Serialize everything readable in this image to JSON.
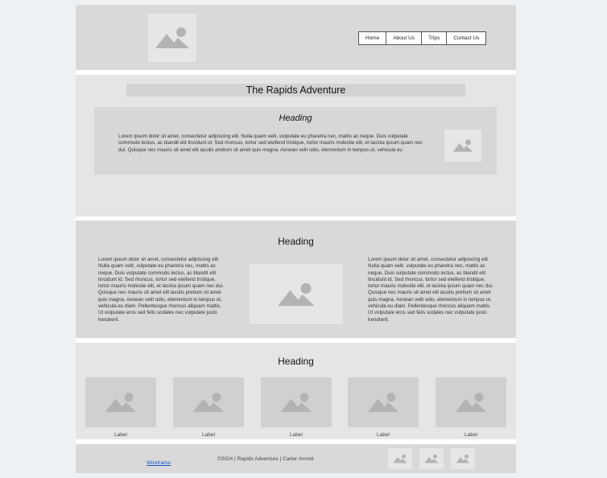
{
  "header": {
    "logo_icon": "image-placeholder-icon",
    "nav": [
      "Home",
      "About Us",
      "Trips",
      "Contact Us"
    ]
  },
  "intro": {
    "title": "The Rapids Adventure",
    "card": {
      "heading": "Heading",
      "text": "Lorem ipsum dolor sit amet, consectetur adipiscing elit. Nulla quam velit, vulputate eu pharetra nec, mattis ac neque. Duis vulputate commodo lectus, ac blandit elit tincidunt id. Sed rhoncus, tortor sed eleifend tristique, tortor mauris molestie elit, et lacinia ipsum quam nec dui. Quisque nec mauris sit amet elit iaculis pretium sit amet quis magna. Aenean velit odio, elementum in tempus ut, vehicula eu"
    }
  },
  "two_col": {
    "heading": "Heading",
    "left_text": "Lorem ipsum dolor sit amet, consectetur adipiscing elit. Nulla quam velit, vulputate eu pharetra nec, mattis ac neque. Duis vulputate commodo lectus, ac blandit elit tincidunt id. Sed rhoncus, tortor sed eleifend tristique, tortor mauris molestie elit, et lacinia ipsum quam nec dui. Quisque nec mauris sit amet elit iaculis pretium sit amet quis magna. Aenean velit odio, elementum in tempus ut, vehicula eu diam. Pellentesque rhoncus aliquam mattis. Ut vulputate eros sed felis sodales nec vulputate justo hendrerit.",
    "right_text": "Lorem ipsum dolor sit amet, consectetur adipiscing elit. Nulla quam velit, vulputate eu pharetra nec, mattis ac neque. Duis vulputate commodo lectus, ac blandit elit tincidunt id. Sed rhoncus, tortor sed eleifend tristique, tortor mauris molestie elit, et lacinia ipsum quam nec dui. Quisque nec mauris sit amet elit iaculis pretium sit amet quis magna. Aenean velit odio, elementum in tempus ut, vehicula eu diam. Pellentesque rhoncus aliquam mattis. Ut vulputate eros sed felis sodales nec vulputate justo hendrerit."
  },
  "gallery": {
    "heading": "Heading",
    "labels": [
      "Label",
      "Label",
      "Label",
      "Label",
      "Label"
    ]
  },
  "footer": {
    "link": "Wireframe",
    "copyright": "©2024 | Rapids Adventure | Carter Arnold"
  },
  "colors": {
    "section_dark": "#d9d9d9",
    "section_light": "#e5e5e5",
    "placeholder_glyph": "#b3b3b3",
    "link": "#1a55d0"
  }
}
